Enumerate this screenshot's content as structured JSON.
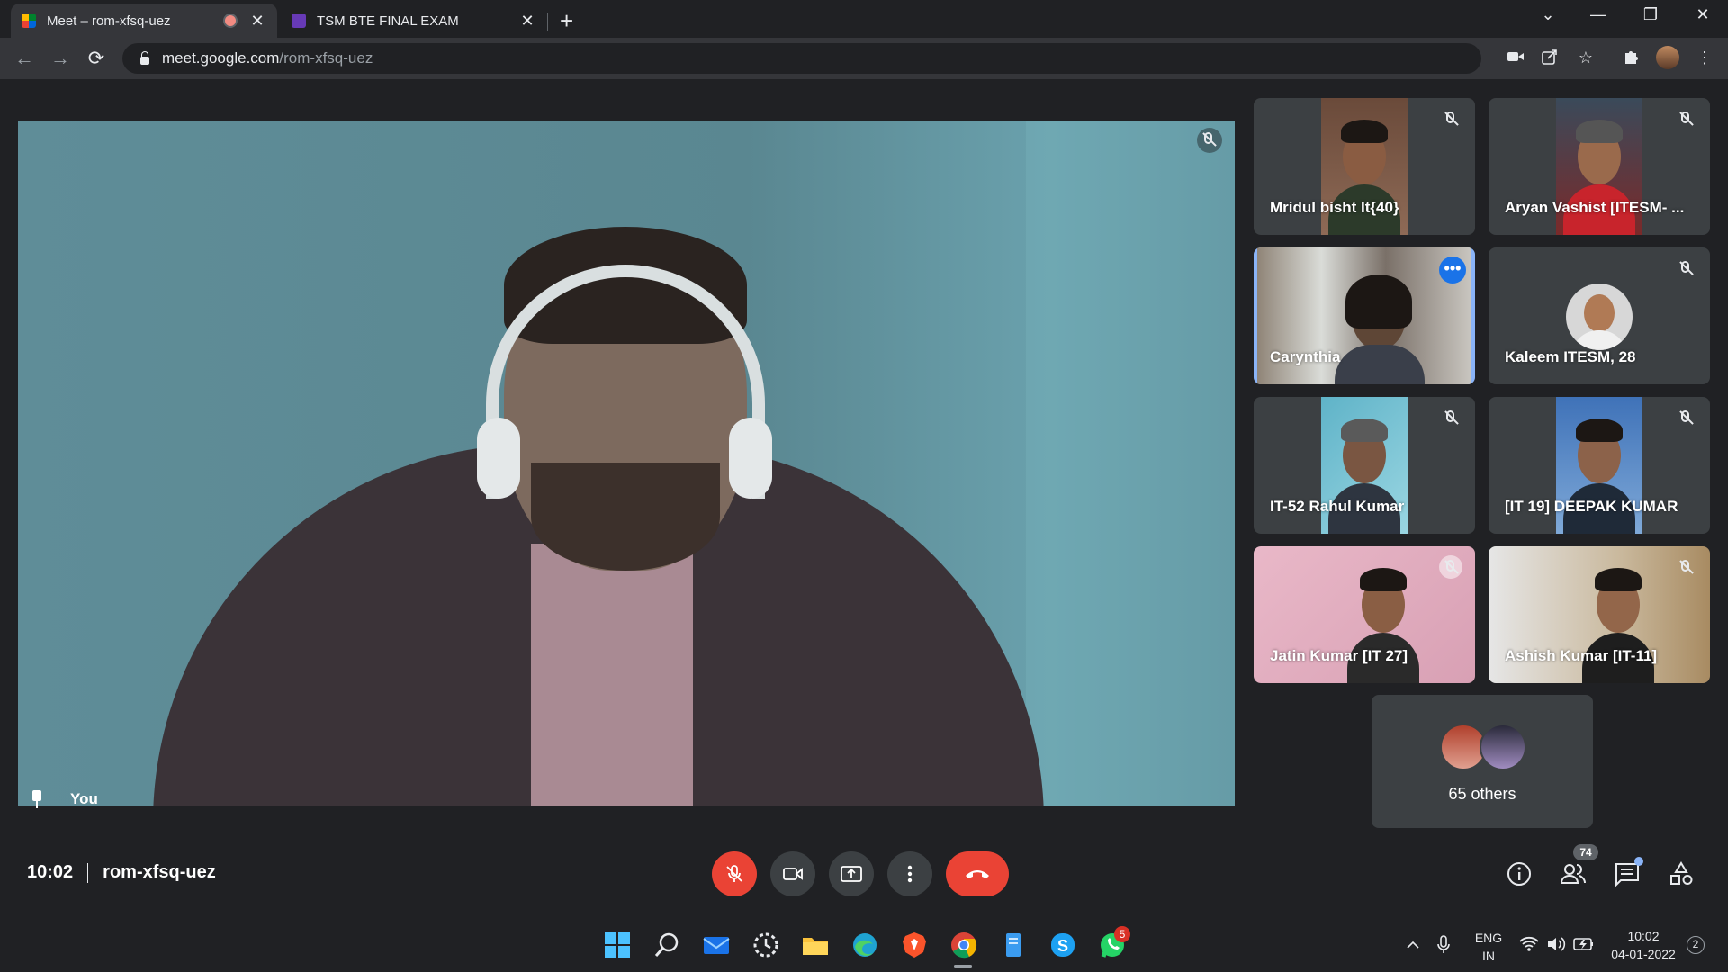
{
  "browser": {
    "tabs": [
      {
        "title": "Meet – rom-xfsq-uez",
        "active": true
      },
      {
        "title": "TSM BTE FINAL EXAM",
        "active": false
      }
    ],
    "url_host": "meet.google.com",
    "url_path": "/rom-xfsq-uez"
  },
  "meeting": {
    "self_label": "You",
    "time": "10:02",
    "code": "rom-xfsq-uez",
    "participant_count": "74",
    "others_label": "65 others"
  },
  "participants": [
    {
      "name": "Mridul bisht It{40}"
    },
    {
      "name": "Aryan Vashist [ITESM- ..."
    },
    {
      "name": "Carynthia"
    },
    {
      "name": "Kaleem ITESM, 28"
    },
    {
      "name": "IT-52 Rahul Kumar"
    },
    {
      "name": "[IT 19] DEEPAK KUMAR"
    },
    {
      "name": "Jatin Kumar [IT 27]"
    },
    {
      "name": "Ashish Kumar [IT-11]"
    }
  ],
  "taskbar": {
    "lang_line1": "ENG",
    "lang_line2": "IN",
    "clock_time": "10:02",
    "clock_date": "04-01-2022",
    "whatsapp_badge": "5",
    "notification_count": "2"
  },
  "colors": {
    "hangup_red": "#ea4335",
    "speaking_border": "#8ab4f8",
    "tile_bg": "#3c4043"
  }
}
